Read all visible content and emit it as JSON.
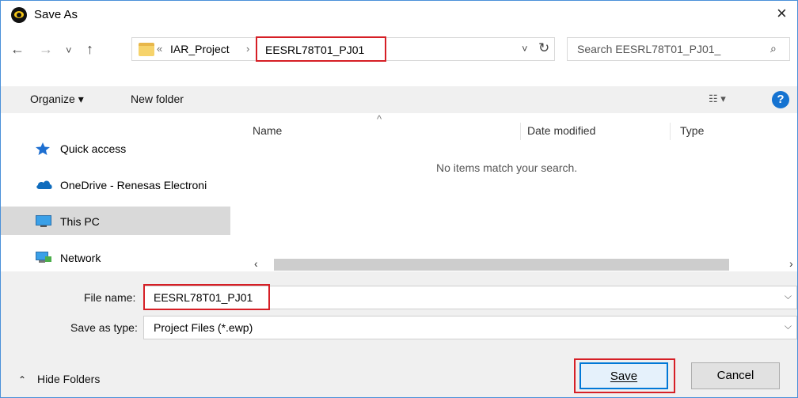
{
  "window": {
    "title": "Save As",
    "close_label": "×"
  },
  "nav": {
    "back": "←",
    "forward": "→",
    "recent": "˅",
    "up": "↑",
    "overflow": "«",
    "parent_folder": "IAR_Project",
    "separator": "›",
    "current_folder": "EESRL78T01_PJ01",
    "dropdown": "˅",
    "refresh": "↻",
    "search_placeholder": "Search EESRL78T01_PJ01_",
    "search_icon": "⌕"
  },
  "toolbar": {
    "organize": "Organize ▾",
    "new_folder": "New folder",
    "view_icon": "☷ ▾",
    "help": "?"
  },
  "sidebar": {
    "items": [
      {
        "label": "Quick access",
        "icon": "star-icon"
      },
      {
        "label": "OneDrive - Renesas Electroni",
        "icon": "cloud-icon"
      },
      {
        "label": "This PC",
        "icon": "computer-icon"
      },
      {
        "label": "Network",
        "icon": "network-icon"
      }
    ],
    "selected": "This PC"
  },
  "file_list": {
    "columns": [
      "Name",
      "Date modified",
      "Type"
    ],
    "empty_message": "No items match your search."
  },
  "form": {
    "file_name_label": "File name:",
    "file_name_value": "EESRL78T01_PJ01",
    "type_label": "Save as type:",
    "type_value": "Project Files (*.ewp)"
  },
  "footer": {
    "hide_folders": "Hide Folders",
    "save": "Save",
    "cancel": "Cancel"
  },
  "colors": {
    "highlight": "#d61f26",
    "accent": "#0078d7"
  }
}
